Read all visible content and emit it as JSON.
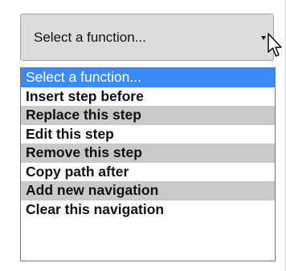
{
  "select": {
    "value": "Select a function..."
  },
  "dropdown": {
    "options": [
      {
        "label": "Select a function..."
      },
      {
        "label": "Insert step before"
      },
      {
        "label": "Replace this step"
      },
      {
        "label": "Edit this step"
      },
      {
        "label": "Remove this step"
      },
      {
        "label": "Copy path after"
      },
      {
        "label": "Add new navigation"
      },
      {
        "label": "Clear this navigation"
      }
    ],
    "selected_index": 0
  },
  "colors": {
    "highlight": "#3b8bf6",
    "shaded_row": "#c9c9c9",
    "select_background": "#dcdcdc"
  },
  "icons": {
    "dropdown_arrow": "caret-down-icon",
    "cursor": "mouse-pointer-icon"
  }
}
